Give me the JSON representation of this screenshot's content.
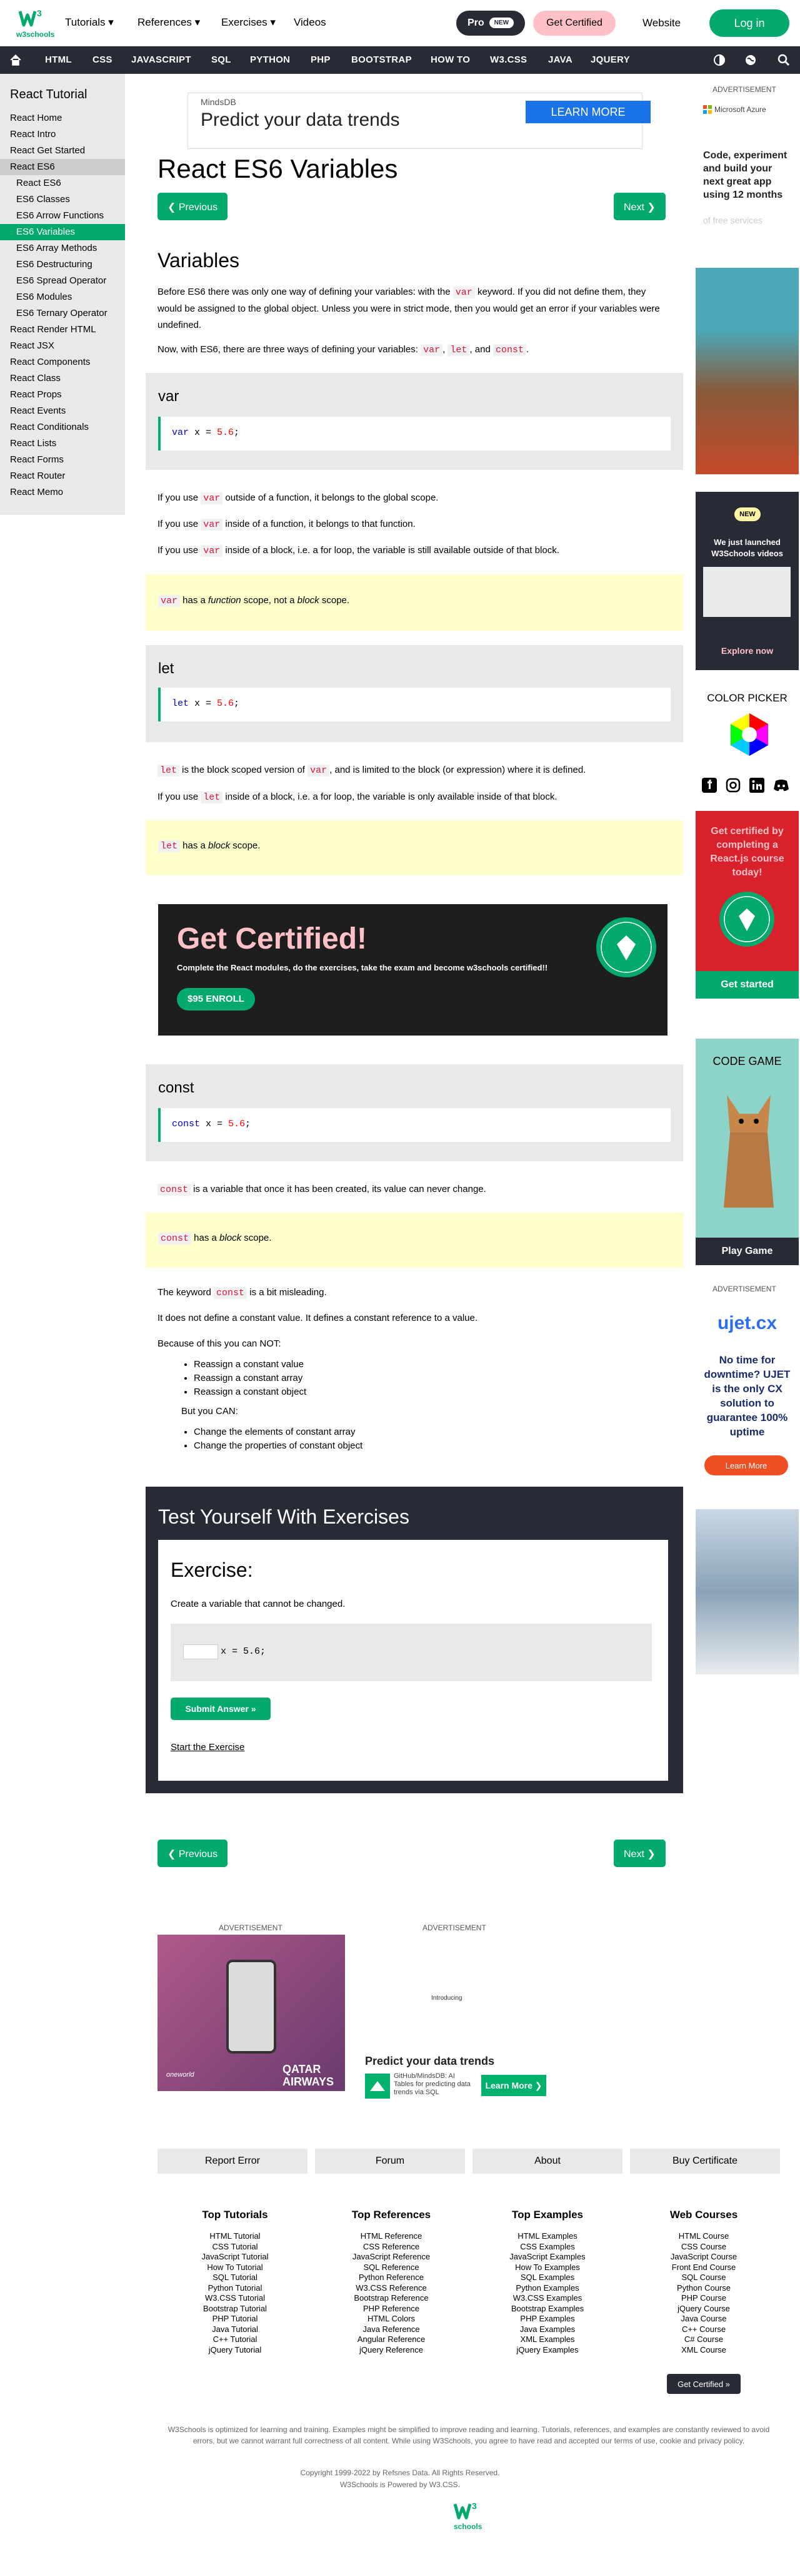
{
  "header": {
    "nav": [
      "Tutorials ▾",
      "References ▾",
      "Exercises ▾",
      "Videos"
    ],
    "pro": "Pro",
    "pro_badge": "NEW",
    "cert": "Get Certified",
    "website": "Website",
    "login": "Log in",
    "logo_text": "w3schools"
  },
  "subnav": [
    "HTML",
    "CSS",
    "JAVASCRIPT",
    "SQL",
    "PYTHON",
    "PHP",
    "BOOTSTRAP",
    "HOW TO",
    "W3.CSS",
    "JAVA",
    "JQUERY"
  ],
  "sidebar": {
    "title": "React Tutorial",
    "items": [
      "React Home",
      "React Intro",
      "React Get Started",
      "React ES6",
      "React ES6",
      "ES6 Classes",
      "ES6 Arrow Functions",
      "ES6 Variables",
      "ES6 Array Methods",
      "ES6 Destructuring",
      "ES6 Spread Operator",
      "ES6 Modules",
      "ES6 Ternary Operator",
      "React Render HTML",
      "React JSX",
      "React Components",
      "React Class",
      "React Props",
      "React Events",
      "React Conditionals",
      "React Lists",
      "React Forms",
      "React Router",
      "React Memo"
    ]
  },
  "topad": {
    "brand": "MindsDB",
    "headline": "Predict your data trends",
    "cta": "LEARN MORE"
  },
  "page": {
    "title": "React ES6 Variables",
    "prev": "❮ Previous",
    "next": "Next ❯",
    "h_variables": "Variables",
    "p1a": "Before ES6 there was only one way of defining your variables: with the ",
    "p1code": "var",
    "p1b": " keyword. If you did not define them, they would be assigned to the global object. Unless you were in strict mode, then you would get an error if your variables were undefined.",
    "p2a": "Now, with ES6, there are three ways of defining your variables: ",
    "p2c1": "var",
    "p2c2": "let",
    "p2c3": "const",
    "var_title": "var",
    "var_code_kw": "var",
    "var_code_mid": " x = ",
    "var_code_num": "5.6",
    "var_code_end": ";",
    "var_p1a": "If you use ",
    "var_p1code": "var",
    "var_p1b": " outside of a function, it belongs to the global scope.",
    "var_p2a": "If you use ",
    "var_p2code": "var",
    "var_p2b": " inside of a function, it belongs to that function.",
    "var_p3a": "If you use ",
    "var_p3code": "var",
    "var_p3b": " inside of a block, i.e. a for loop, the variable is still available outside of that block.",
    "var_note_code": "var",
    "var_note_a": " has a ",
    "var_note_i1": "function",
    "var_note_b": " scope, not a ",
    "var_note_i2": "block",
    "var_note_c": " scope.",
    "let_title": "let",
    "let_code_kw": "let",
    "let_code_mid": " x = ",
    "let_code_num": "5.6",
    "let_code_end": ";",
    "let_p1code": "let",
    "let_p1a": " is the block scoped version of ",
    "let_p1code2": "var",
    "let_p1b": ", and is limited to the block (or expression) where it is defined.",
    "let_p2a": "If you use ",
    "let_p2code": "let",
    "let_p2b": " inside of a block, i.e. a for loop, the variable is only available inside of that block.",
    "let_note_code": "let",
    "let_note_a": " has a ",
    "let_note_i": "block",
    "let_note_b": " scope.",
    "cert_title": "Get Certified!",
    "cert_text": "Complete the React modules, do the exercises, take the exam and become w3schools certified!!",
    "cert_btn": "$95 ENROLL",
    "const_title": "const",
    "const_code_kw": "const",
    "const_code_mid": " x = ",
    "const_code_num": "5.6",
    "const_code_end": ";",
    "const_p1code": "const",
    "const_p1": " is a variable that once it has been created, its value can never change.",
    "const_note_code": "const",
    "const_note_a": " has a ",
    "const_note_i": "block",
    "const_note_b": " scope.",
    "const_p2a": "The keyword ",
    "const_p2code": "const",
    "const_p2b": " is a bit misleading.",
    "const_p3": "It does not define a constant value. It defines a constant reference to a value.",
    "const_p4": "Because of this you can NOT:",
    "cannot": [
      "Reassign a constant value",
      "Reassign a constant array",
      "Reassign a constant object"
    ],
    "const_p5": "But you CAN:",
    "can": [
      "Change the elements of constant array",
      "Change the properties of constant object"
    ],
    "ex_heading": "Test Yourself With Exercises",
    "ex_title": "Exercise:",
    "ex_text": "Create a variable that cannot be changed.",
    "ex_code": " x = 5.6;",
    "ex_submit": "Submit Answer »",
    "ex_start": "Start the Exercise"
  },
  "right": {
    "ad_label": "ADVERTISEMENT",
    "azure_brand": "Microsoft Azure",
    "azure_text": "Code, experiment and build your next great app using 12 months",
    "azure_faded": "of free services",
    "new_badge": "NEW",
    "video_text": "We just launched W3Schools videos",
    "explore": "Explore now",
    "color_picker": "COLOR PICKER",
    "cert_text": "Get certified by completing a React.js course today!",
    "get_started": "Get started",
    "code_game": "CODE GAME",
    "play": "Play Game",
    "ujet_brand": "ujet.cx",
    "ujet_text": "No time for downtime? UJET is the only CX solution to guarantee 100% uptime",
    "ujet_cta": "Learn More"
  },
  "bottom_ads": {
    "label1": "ADVERTISEMENT",
    "label2": "ADVERTISEMENT",
    "qatar": "QATAR AIRWAYS",
    "oneworld": "oneworld",
    "introducing": "Introducing",
    "predict": "Predict your data trends",
    "mindsdb_text": "GitHub/MindsDB: AI Tables for predicting data trends via SQL",
    "learn": "Learn More ❯"
  },
  "footer": {
    "buttons": [
      "Report Error",
      "Forum",
      "About",
      "Buy Certificate"
    ],
    "cols": [
      {
        "title": "Top Tutorials",
        "items": [
          "HTML Tutorial",
          "CSS Tutorial",
          "JavaScript Tutorial",
          "How To Tutorial",
          "SQL Tutorial",
          "Python Tutorial",
          "W3.CSS Tutorial",
          "Bootstrap Tutorial",
          "PHP Tutorial",
          "Java Tutorial",
          "C++ Tutorial",
          "jQuery Tutorial"
        ]
      },
      {
        "title": "Top References",
        "items": [
          "HTML Reference",
          "CSS Reference",
          "JavaScript Reference",
          "SQL Reference",
          "Python Reference",
          "W3.CSS Reference",
          "Bootstrap Reference",
          "PHP Reference",
          "HTML Colors",
          "Java Reference",
          "Angular Reference",
          "jQuery Reference"
        ]
      },
      {
        "title": "Top Examples",
        "items": [
          "HTML Examples",
          "CSS Examples",
          "JavaScript Examples",
          "How To Examples",
          "SQL Examples",
          "Python Examples",
          "W3.CSS Examples",
          "Bootstrap Examples",
          "PHP Examples",
          "Java Examples",
          "XML Examples",
          "jQuery Examples"
        ]
      },
      {
        "title": "Web Courses",
        "items": [
          "HTML Course",
          "CSS Course",
          "JavaScript Course",
          "Front End Course",
          "SQL Course",
          "Python Course",
          "PHP Course",
          "jQuery Course",
          "Java Course",
          "C++ Course",
          "C# Course",
          "XML Course"
        ]
      }
    ],
    "get_certified": "Get Certified »",
    "disclaimer": "W3Schools is optimized for learning and training. Examples might be simplified to improve reading and learning. Tutorials, references, and examples are constantly reviewed to avoid errors, but we cannot warrant full correctness of all content. While using W3Schools, you agree to have read and accepted our terms of use, cookie and privacy policy.",
    "copyright": "Copyright 1999-2022 by Refsnes Data. All Rights Reserved.",
    "powered": "W3Schools is Powered by W3.CSS."
  }
}
